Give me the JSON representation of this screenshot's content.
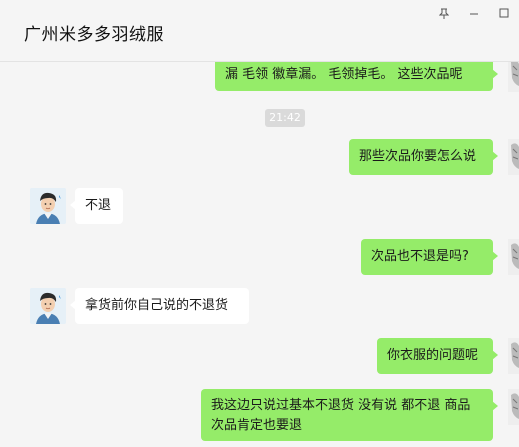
{
  "window": {
    "title": "广州米多多羽绒服",
    "pin_icon": "pin-icon",
    "minimize_icon": "minimize-icon",
    "maximize_icon": "maximize-icon"
  },
  "timestamp": "21:42",
  "messages": [
    {
      "side": "out",
      "text": "漏 毛领  徽章漏。 毛领掉毛。 这些次品呢"
    },
    {
      "side": "out",
      "text": "那些次品你要怎么说"
    },
    {
      "side": "in",
      "text": "不退"
    },
    {
      "side": "out",
      "text": "次品也不退是吗?"
    },
    {
      "side": "in",
      "text": "拿货前你自己说的不退货"
    },
    {
      "side": "out",
      "text": "你衣服的问题呢"
    },
    {
      "side": "out",
      "text": "我这边只说过基本不退货 没有说 都不退  商品次品肯定也要退"
    }
  ],
  "colors": {
    "outgoing_bubble": "#95ec69",
    "incoming_bubble": "#ffffff",
    "background": "#f5f5f5"
  }
}
